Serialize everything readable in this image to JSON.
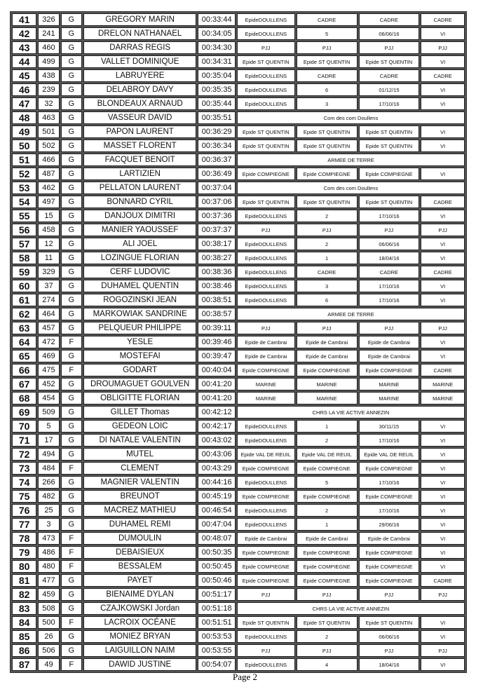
{
  "rows": [
    [
      "41",
      "326",
      "G",
      "GREGORY MARIN",
      "00:33:44",
      "EpideDOULLENS",
      "CADRE",
      "CADRE",
      "CADRE"
    ],
    [
      "42",
      "241",
      "G",
      "DRELON NATHANAEL",
      "00:34:05",
      "EpideDOULLENS",
      "5",
      "06/06/16",
      "VI"
    ],
    [
      "43",
      "460",
      "G",
      "DARRAS REGIS",
      "00:34:30",
      "PJJ",
      "PJJ",
      "PJJ",
      "PJJ"
    ],
    [
      "44",
      "499",
      "G",
      "VALLET DOMINIQUE",
      "00:34:31",
      "Epide ST QUENTIN",
      "Epide ST QUENTIN",
      "Epide ST QUENTIN",
      "VI"
    ],
    [
      "45",
      "438",
      "G",
      "LABRUYERE",
      "00:35:04",
      "EpideDOULLENS",
      "CADRE",
      "CADRE",
      "CADRE"
    ],
    [
      "46",
      "239",
      "G",
      "DELABROY DAVY",
      "00:35:35",
      "EpideDOULLENS",
      "6",
      "01/12/15",
      "VI"
    ],
    [
      "47",
      "32",
      "G",
      "BLONDEAUX ARNAUD",
      "00:35:44",
      "EpideDOULLENS",
      "3",
      "17/10/16",
      "VI"
    ],
    [
      "48",
      "463",
      "G",
      "VASSEUR DAVID",
      "00:35:51",
      "Com des com Doullens"
    ],
    [
      "49",
      "501",
      "G",
      "PAPON LAURENT",
      "00:36:29",
      "Epide ST QUENTIN",
      "Epide ST QUENTIN",
      "Epide ST QUENTIN",
      "VI"
    ],
    [
      "50",
      "502",
      "G",
      "MASSET FLORENT",
      "00:36:34",
      "Epide ST QUENTIN",
      "Epide ST QUENTIN",
      "Epide ST QUENTIN",
      "VI"
    ],
    [
      "51",
      "466",
      "G",
      "FACQUET BENOIT",
      "00:36:37",
      "ARMEE DE TERRE"
    ],
    [
      "52",
      "487",
      "G",
      "LARTIZIEN",
      "00:36:49",
      "Epide COMPIEGNE",
      "Epide COMPIEGNE",
      "Epide COMPIEGNE",
      "VI"
    ],
    [
      "53",
      "462",
      "G",
      "PELLATON LAURENT",
      "00:37:04",
      "Com des com Doullens"
    ],
    [
      "54",
      "497",
      "G",
      "BONNARD CYRIL",
      "00:37:06",
      "Epide ST QUENTIN",
      "Epide ST QUENTIN",
      "Epide ST QUENTIN",
      "CADRE"
    ],
    [
      "55",
      "15",
      "G",
      "DANJOUX DIMITRI",
      "00:37:36",
      "EpideDOULLENS",
      "2",
      "17/10/16",
      "VI"
    ],
    [
      "56",
      "458",
      "G",
      "MANIER YAOUSSEF",
      "00:37:37",
      "PJJ",
      "PJJ",
      "PJJ",
      "PJJ"
    ],
    [
      "57",
      "12",
      "G",
      "ALI JOEL",
      "00:38:17",
      "EpideDOULLENS",
      "2",
      "06/06/16",
      "VI"
    ],
    [
      "58",
      "11",
      "G",
      "LOZINGUE FLORIAN",
      "00:38:27",
      "EpideDOULLENS",
      "1",
      "18/04/16",
      "VI"
    ],
    [
      "59",
      "329",
      "G",
      "CERF  LUDOVIC",
      "00:38:36",
      "EpideDOULLENS",
      "CADRE",
      "CADRE",
      "CADRE"
    ],
    [
      "60",
      "37",
      "G",
      "DUHAMEL QUENTIN",
      "00:38:46",
      "EpideDOULLENS",
      "3",
      "17/10/16",
      "VI"
    ],
    [
      "61",
      "274",
      "G",
      "ROGOZINSKI JEAN",
      "00:38:51",
      "EpideDOULLENS",
      "6",
      "17/10/16",
      "VI"
    ],
    [
      "62",
      "464",
      "G",
      "MARKOWIAK SANDRINE",
      "00:38:57",
      "ARMEE DE TERRE"
    ],
    [
      "63",
      "457",
      "G",
      "PELQUEUR PHILIPPE",
      "00:39:11",
      "PJJ",
      "PJJ",
      "PJJ",
      "PJJ"
    ],
    [
      "64",
      "472",
      "F",
      "YESLE",
      "00:39:46",
      "Epide de Cambrai",
      "Epide de Cambrai",
      "Epide de Cambrai",
      "VI"
    ],
    [
      "65",
      "469",
      "G",
      "MOSTEFAI",
      "00:39:47",
      "Epide de Cambrai",
      "Epide de Cambrai",
      "Epide de Cambrai",
      "VI"
    ],
    [
      "66",
      "475",
      "F",
      "GODART",
      "00:40:04",
      "Epide COMPIEGNE",
      "Epide COMPIEGNE",
      "Epide COMPIEGNE",
      "CADRE"
    ],
    [
      "67",
      "452",
      "G",
      "DROUMAGUET GOULVEN",
      "00:41:20",
      "MARINE",
      "MARINE",
      "MARINE",
      "MARINE"
    ],
    [
      "68",
      "454",
      "G",
      "OBLIGITTE FLORIAN",
      "00:41:20",
      "MARINE",
      "MARINE",
      "MARINE",
      "MARINE"
    ],
    [
      "69",
      "509",
      "G",
      "GILLET Thomas",
      "00:42:12",
      "CHRS LA VIE ACTIVE ANNEZIN"
    ],
    [
      "70",
      "5",
      "G",
      "GEDEON LOIC",
      "00:42:17",
      "EpideDOULLENS",
      "1",
      "30/11/15",
      "VI"
    ],
    [
      "71",
      "17",
      "G",
      "DI NATALE VALENTIN",
      "00:43:02",
      "EpideDOULLENS",
      "2",
      "17/10/16",
      "VI"
    ],
    [
      "72",
      "494",
      "G",
      "MUTEL",
      "00:43:06",
      "Epide VAL DE REUIL",
      "Epide VAL DE REUIL",
      "Epide VAL DE REUIL",
      "VI"
    ],
    [
      "73",
      "484",
      "F",
      "CLEMENT",
      "00:43:29",
      "Epide COMPIEGNE",
      "Epide COMPIEGNE",
      "Epide COMPIEGNE",
      "VI"
    ],
    [
      "74",
      "266",
      "G",
      "MAGNIER VALENTIN",
      "00:44:16",
      "EpideDOULLENS",
      "5",
      "17/10/16",
      "VI"
    ],
    [
      "75",
      "482",
      "G",
      "BREUNOT",
      "00:45:19",
      "Epide COMPIEGNE",
      "Epide COMPIEGNE",
      "Epide COMPIEGNE",
      "VI"
    ],
    [
      "76",
      "25",
      "G",
      "MACREZ MATHIEU",
      "00:46:54",
      "EpideDOULLENS",
      "2",
      "17/10/16",
      "VI"
    ],
    [
      "77",
      "3",
      "G",
      "DUHAMEL REMI",
      "00:47:04",
      "EpideDOULLENS",
      "1",
      "29/06/16",
      "VI"
    ],
    [
      "78",
      "473",
      "F",
      "DUMOULIN",
      "00:48:07",
      "Epide de Cambrai",
      "Epide de Cambrai",
      "Epide de Cambrai",
      "VI"
    ],
    [
      "79",
      "486",
      "F",
      "DEBAISIEUX",
      "00:50:35",
      "Epide COMPIEGNE",
      "Epide COMPIEGNE",
      "Epide COMPIEGNE",
      "VI"
    ],
    [
      "80",
      "480",
      "F",
      "BESSALEM",
      "00:50:45",
      "Epide COMPIEGNE",
      "Epide COMPIEGNE",
      "Epide COMPIEGNE",
      "VI"
    ],
    [
      "81",
      "477",
      "G",
      "PAYET",
      "00:50:46",
      "Epide COMPIEGNE",
      "Epide COMPIEGNE",
      "Epide COMPIEGNE",
      "CADRE"
    ],
    [
      "82",
      "459",
      "G",
      "BIENAIME DYLAN",
      "00:51:17",
      "PJJ",
      "PJJ",
      "PJJ",
      "PJJ"
    ],
    [
      "83",
      "508",
      "G",
      "CZAJKOWSKI Jordan",
      "00:51:18",
      "CHRS LA VIE ACTIVE ANNEZIN"
    ],
    [
      "84",
      "500",
      "F",
      "LACROIX OCÉANE",
      "00:51:51",
      "Epide ST QUENTIN",
      "Epide ST QUENTIN",
      "Epide ST QUENTIN",
      "VI"
    ],
    [
      "85",
      "26",
      "G",
      "MONIEZ BRYAN",
      "00:53:53",
      "EpideDOULLENS",
      "2",
      "06/06/16",
      "VI"
    ],
    [
      "86",
      "506",
      "G",
      "LAIGUILLON NAIM",
      "00:53:55",
      "PJJ",
      "PJJ",
      "PJJ",
      "PJJ"
    ],
    [
      "87",
      "49",
      "F",
      "DAWID JUSTINE",
      "00:54:07",
      "EpideDOULLENS",
      "4",
      "18/04/16",
      "VI"
    ]
  ],
  "footer": {
    "page": "Page 2"
  }
}
